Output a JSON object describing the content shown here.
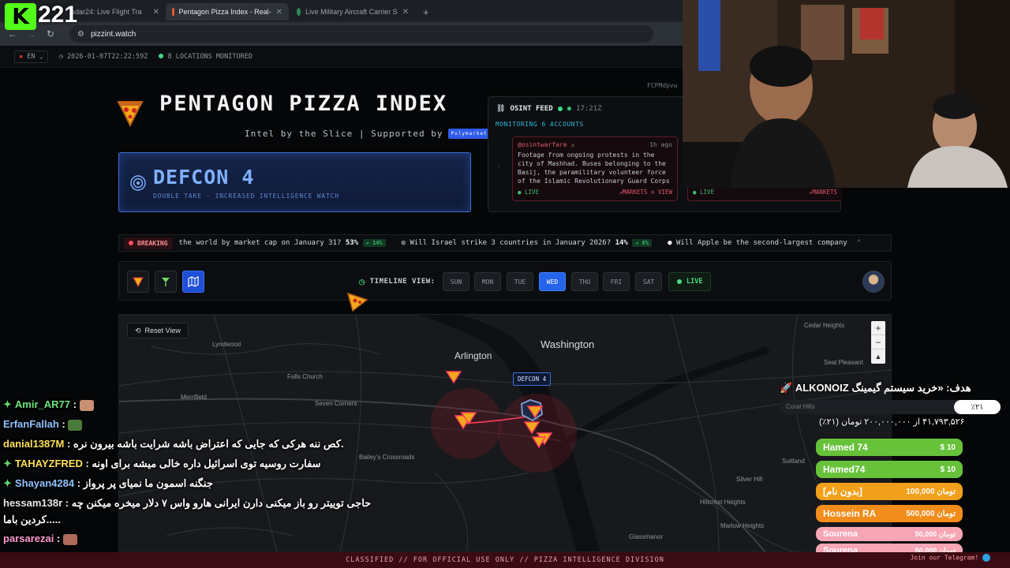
{
  "browser": {
    "tabs": [
      {
        "label": "adar24: Live Flight Tra",
        "active": false
      },
      {
        "label": "Pentagon Pizza Index - Real-",
        "active": true
      },
      {
        "label": "Live Military Aircraft Carrier S",
        "active": false
      }
    ],
    "url": "pizzint.watch"
  },
  "statusbar": {
    "language": "EN",
    "timestamp": "2026-01-07T22:22:59Z",
    "locations": "8 LOCATIONS MONITORED",
    "right_code": "FCPMdpvw"
  },
  "header": {
    "title": "PENTAGON PIZZA INDEX",
    "tagline": "Intel by the Slice | Supported by",
    "sponsor": "Polymarket"
  },
  "defcon": {
    "level": "DEFCON 4",
    "subtitle": "DOUBLE TAKE · INCREASED INTELLIGENCE WATCH"
  },
  "osint": {
    "title": "OSINT FEED",
    "time": "17:21Z",
    "monitoring": "MONITORING 6 ACCOUNTS",
    "card": {
      "handle": "@osintwarfare",
      "ago": "1h ago",
      "text": "Footage from ongoing protests in the city of Mashhad. Buses belonging to the Basij, the paramilitary volunteer force of the Islamic Revolutionary Guard Corps (IRGC)...",
      "live": "LIVE",
      "markets": "MARKETS",
      "view": "VIEW"
    },
    "card2": {
      "live": "LIVE",
      "markets": "MARKETS"
    }
  },
  "ticker": {
    "breaking": "BREAKING",
    "items": [
      {
        "text": "the world by market cap on January 31?",
        "pct": "53%",
        "delta": "↗ 14%"
      },
      {
        "text": "Will Israel strike 3 countries in January 2026?",
        "pct": "14%",
        "delta": "↗ 6%"
      },
      {
        "text": "Will Apple be the second-largest company",
        "pct": "",
        "delta": ""
      }
    ]
  },
  "controls": {
    "timeline_label": "TIMELINE VIEW:",
    "days": [
      "SUN",
      "MON",
      "TUE",
      "WED",
      "THU",
      "FRI",
      "SAT"
    ],
    "active_day": "WED",
    "live": "LIVE"
  },
  "map": {
    "reset_view": "Reset View",
    "defcon_marker": "DEFCON 4",
    "labels": {
      "washington": "Washington",
      "arlington": "Arlington",
      "cedar_heights": "Cedar Heights",
      "seat_pleasant": "Seat Pleasant",
      "coral_hills": "Coral Hills",
      "lyndwood": "Lyndwood",
      "falls_church": "Falls Church",
      "merrifield": "Merrifield",
      "seven_corners": "Seven Corners",
      "baileys_crossroads": "Bailey's Crossroads",
      "suitland": "Suitland",
      "silver_hill": "Silver Hill",
      "hillcrest_heights": "Hillcrest Heights",
      "marlow_heights": "Marlow Heights",
      "glassmanor": "Glassmanor"
    },
    "zoom": [
      "+",
      "−",
      "▲"
    ]
  },
  "chat": [
    {
      "user": "Amir_AR77",
      "msg": "",
      "star": true
    },
    {
      "user": "ErfanFallah",
      "msg": "",
      "star": false
    },
    {
      "user": "danial1387M",
      "msg": "کص ننه هرکی که جایی که اعتراض باشه شرایت باشه بیرون نره.",
      "star": false
    },
    {
      "user": "TAHAYZFRED",
      "msg": "سفارت روسیه توی اسرائیل داره خالی میشه برای اونه",
      "star": true
    },
    {
      "user": "Shayan4284",
      "msg": "جنگنه اسمون ما نمیای پر پرواز",
      "star": true
    },
    {
      "user": "hessam138r",
      "msg": "حاجی توییتر رو باز میکنی دارن ایرانی هارو واس ۷ دلار میخره میکنن چه",
      "star": false
    },
    {
      "user": "",
      "msg": "کردین باما.....",
      "star": false
    },
    {
      "user": "parsarezai",
      "msg": "",
      "star": false
    },
    {
      "user": "parsarezai",
      "msg": "",
      "star": false
    }
  ],
  "donations": {
    "goal_title": "هدف: «خرید سیستم گیمینگ ALKONOIZ 🚀",
    "goal_percent": "٪۲۱",
    "goal_fraction": 0.21,
    "goal_placeholder": "Coral Hills",
    "goal_progress": "۴۱,۷۹۳,۵۲۶ از ۲۰۰,۰۰۰,۰۰۰ تومان (۲۱٪)",
    "items": [
      {
        "name": "Hamed 74",
        "amount": "$ 10",
        "color": "#67c23a"
      },
      {
        "name": "Hamed74",
        "amount": "$ 10",
        "color": "#67c23a"
      },
      {
        "name": "[بدون نام]",
        "amount": "100,000 تومان",
        "color": "#f2a01b"
      },
      {
        "name": "Hossein RA",
        "amount": "500,000 تومان",
        "color": "#f28c1b"
      },
      {
        "name": "Sourena",
        "amount": "50,000 تومان",
        "color": "#f7a6b5"
      },
      {
        "name": "Sourena",
        "amount": "50,000 تومان",
        "color": "#f7a6b5"
      }
    ]
  },
  "kick": {
    "viewers": "221",
    "logo": "K"
  },
  "footer": {
    "classified": "CLASSIFIED // FOR OFFICIAL USE ONLY // PIZZA INTELLIGENCE DIVISION",
    "telegram": "Join our Telegram!"
  }
}
